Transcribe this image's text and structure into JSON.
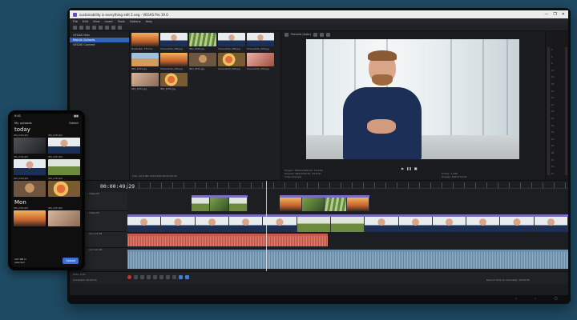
{
  "window": {
    "title": "sustainability is everything edit 2.veg - VEGAS Pro 19.0",
    "controls": [
      "—",
      "❐",
      "✕"
    ]
  },
  "menu": [
    "File",
    "Edit",
    "View",
    "Insert",
    "Tools",
    "Options",
    "Help"
  ],
  "explorer": {
    "header": "VEGAS Hub",
    "items": [
      "Mobile Uploads",
      "VEGAS Content"
    ],
    "selected": 0
  },
  "media": {
    "tab": "VEGAS Hub Explorer",
    "thumbs": [
      {
        "name": "Duplicate...TE.mov",
        "style": "t-sunset"
      },
      {
        "name": "Screenshot_200.jpg",
        "style": "t-man"
      },
      {
        "name": "IMG_6348.jpg",
        "style": "t-stripe"
      },
      {
        "name": "Screenshot_200.jpg",
        "style": "t-man"
      },
      {
        "name": "Screenshot_200.jpg",
        "style": "t-man"
      },
      {
        "name": "IMG_6354.jpg",
        "style": "t-desert"
      },
      {
        "name": "Screenshot_200.jpg",
        "style": "t-sunset"
      },
      {
        "name": "IMG_6352.jpg",
        "style": "t-cat"
      },
      {
        "name": "Screenshot_200.jpg",
        "style": "t-food"
      },
      {
        "name": "Screenshot_200.jpg",
        "style": "t-pink"
      },
      {
        "name": "IMG_6355.jpg",
        "style": "t-hands"
      },
      {
        "name": "IMG_6356.jpg",
        "style": "t-food"
      }
    ],
    "status": "Size: 22.8 MB  720x1280  00:00:06:06"
  },
  "preview": {
    "label": "Preview (Auto)",
    "info_left": [
      "Project: 3840x2160x32, 29.970i",
      "Preview: 960x540x32, 29.970i",
      "Video Preview"
    ],
    "info_right": [
      "Frame: 1,498",
      "Display: 662x372x32"
    ]
  },
  "meters": {
    "scale": [
      "-3",
      "-6",
      "-9",
      "-12",
      "-15",
      "-18",
      "-21",
      "-24",
      "-27",
      "-30",
      "-33",
      "-36",
      "-39",
      "-42",
      "-45",
      "-48",
      "-51",
      "-54",
      "-57"
    ]
  },
  "timeline": {
    "timecode": "00:00:49;29",
    "tracks": [
      "Video FX",
      "Video FX",
      "Vol: 0.0 dB",
      "Vol: 0.0 dB"
    ],
    "rate": "Rate: 0.00",
    "complete": "Complete: 00:00:01",
    "record_time": "Record Time (2 channels): 24:09:55"
  },
  "phone": {
    "time": "9:41",
    "header_left": "My uploads",
    "header_right": "Select",
    "sections": [
      {
        "title": "today",
        "thumbs": [
          {
            "name": "IMG_6344.JPG",
            "style": "t-dark"
          },
          {
            "name": "IMG_6345.JPG",
            "style": "t-man"
          },
          {
            "name": "IMG_6346.JPG",
            "style": "t-man"
          },
          {
            "name": "IMG_6347.JPG",
            "style": "t-field"
          },
          {
            "name": "IMG_6348.JPG",
            "style": "t-cat"
          },
          {
            "name": "IMG_6349.JPG",
            "style": "t-food"
          }
        ]
      },
      {
        "title": "Mon",
        "thumbs": [
          {
            "name": "IMG_6350.JPG",
            "style": "t-sunset"
          },
          {
            "name": "IMG_6351.JPG",
            "style": "t-hands"
          }
        ]
      }
    ],
    "selection": "297 MB in",
    "selection2": "selected",
    "upload_label": "Upload"
  }
}
